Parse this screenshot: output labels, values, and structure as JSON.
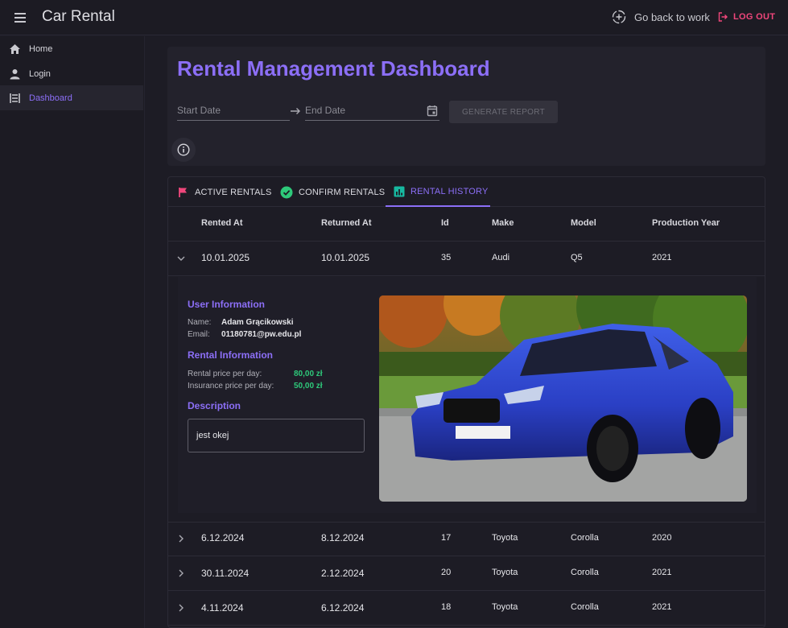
{
  "app": {
    "title": "Car Rental"
  },
  "header": {
    "go_back": "Go back to work",
    "logout": "LOG OUT"
  },
  "sidebar": {
    "items": [
      {
        "label": "Home"
      },
      {
        "label": "Login"
      },
      {
        "label": "Dashboard"
      }
    ]
  },
  "dashboard": {
    "title": "Rental Management Dashboard",
    "start_date_placeholder": "Start Date",
    "end_date_placeholder": "End Date",
    "report_button": "GENERATE REPORT"
  },
  "tabs": [
    {
      "label": "ACTIVE RENTALS"
    },
    {
      "label": "CONFIRM RENTALS"
    },
    {
      "label": "RENTAL HISTORY"
    }
  ],
  "table": {
    "columns": [
      "Rented At",
      "Returned At",
      "Id",
      "Make",
      "Model",
      "Production Year"
    ],
    "rows": [
      [
        "10.01.2025",
        "10.01.2025",
        "35",
        "Audi",
        "Q5",
        "2021"
      ],
      [
        "6.12.2024",
        "8.12.2024",
        "17",
        "Toyota",
        "Corolla",
        "2020"
      ],
      [
        "30.11.2024",
        "2.12.2024",
        "20",
        "Toyota",
        "Corolla",
        "2021"
      ],
      [
        "4.11.2024",
        "6.12.2024",
        "18",
        "Toyota",
        "Corolla",
        "2021"
      ]
    ]
  },
  "detail": {
    "user_title": "User Information",
    "name_label": "Name:",
    "name_value": "Adam Grącikowski",
    "email_label": "Email:",
    "email_value": "01180781@pw.edu.pl",
    "rental_title": "Rental Information",
    "price_label": "Rental price per day:",
    "price_value": "80,00 zł",
    "insurance_label": "Insurance price per day:",
    "insurance_value": "50,00 zł",
    "description_title": "Description",
    "description_value": "jest okej"
  },
  "colors": {
    "accent": "#8c6ff7",
    "logout": "#f0467b",
    "green": "#2ec97a",
    "background": "#1d1c25"
  },
  "icons": [
    "menu-icon",
    "plus-circle-icon",
    "logout-icon",
    "home-icon",
    "person-icon",
    "dashboard-icon",
    "arrow-right-icon",
    "calendar-icon",
    "info-icon",
    "flag-icon",
    "check-circle-icon",
    "bar-chart-icon",
    "chevron-down-icon",
    "chevron-right-icon"
  ]
}
